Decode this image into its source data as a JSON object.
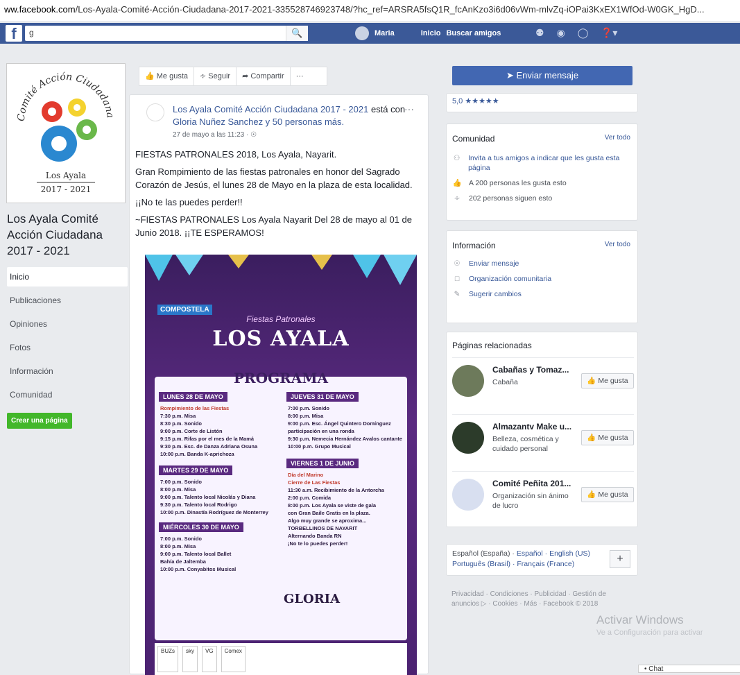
{
  "browser": {
    "domain": "ww.facebook.com",
    "url_path": "/Los-Ayala-Comité-Acción-Ciudadana-2017-2021-335528746923748/?hc_ref=ARSRA5fsQ1R_fcAnKzo3i6d06vWm-mlvZq-iOPai3KxEX1WfOd-W0GK_HgD..."
  },
  "topbar": {
    "search_value": "g",
    "user_name": "Maria",
    "nav_home": "Inicio",
    "nav_find_friends": "Buscar amigos"
  },
  "profile": {
    "logo_text_top": "Comité Acción Ciudadana",
    "logo_text_place": "Los Ayala",
    "logo_text_years": "2017 - 2021",
    "page_name": "Los Ayala Comité Acción Ciudadana 2017 - 2021"
  },
  "left_nav": {
    "items": [
      "Inicio",
      "Publicaciones",
      "Opiniones",
      "Fotos",
      "Información",
      "Comunidad"
    ],
    "create_page": "Crear una página"
  },
  "actions": {
    "like": "Me gusta",
    "follow": "Seguir",
    "share": "Compartir",
    "more": "···"
  },
  "post": {
    "author": "Los Ayala Comité Acción Ciudadana 2017 - 2021",
    "with_text": "está con",
    "tagged": "Gloria Nuñez Sanchez y 50 personas más.",
    "date": "27 de mayo a las 11:23 ·",
    "p1": "FIESTAS PATRONALES 2018, Los Ayala, Nayarit.",
    "p2": "Gran Rompimiento de las fiestas patronales en honor del Sagrado Corazón de Jesús, el lunes 28 de Mayo en la plaza de esta localidad.",
    "p3": "¡¡No te las puedes perder!!",
    "p4": "~FIESTAS PATRONALES Los Ayala Nayarit Del 28 de mayo al 01 de Junio 2018. ¡¡TE ESPERAMOS!"
  },
  "poster": {
    "compostela": "COMPOSTELA",
    "subtitle": "Fiestas Patronales",
    "title": "LOS AYALA",
    "programa": "PROGRAMA",
    "day1": "LUNES 28 DE MAYO",
    "day1_lines": [
      "Rompimiento de las Fiestas",
      "7:30 p.m.  Misa",
      "8:30 p.m.  Sonido",
      "9:00 p.m.  Corte de Listón",
      "9:15 p.m.  Rifas por el mes de la Mamá",
      "9:30 p.m.  Esc. de Danza Adriana Osuna",
      "10:00 p.m.  Banda K-aprichoza"
    ],
    "day2": "MARTES 29 DE MAYO",
    "day2_lines": [
      "7:00 p.m.  Sonido",
      "8:00 p.m.  Misa",
      "9:00 p.m.  Talento local Nicolás y Diana",
      "9:30 p.m.  Talento local Rodrigo",
      "10:00 p.m.  Dinastía Rodríguez de Monterrey"
    ],
    "day3": "MIÉRCOLES 30 DE MAYO",
    "day3_lines": [
      "7:00 p.m.  Sonido",
      "8:00 p.m.  Misa",
      "9:00 p.m.  Talento local Ballet",
      "Bahía de Jaltemba",
      "10:00 p.m.  Conyabitos Musical"
    ],
    "day4": "JUEVES 31 DE MAYO",
    "day4_lines": [
      "7:00 p.m.  Sonido",
      "8:00 p.m.  Misa",
      "9:00 p.m.  Esc. Ángel Quintero Domínguez",
      "participación en una ronda",
      "9:30 p.m.  Nemecia Hernández Avalos cantante",
      "10:00 p.m.  Grupo Musical"
    ],
    "day5": "VIERNES 1 DE JUNIO",
    "day5_lines": [
      "Día del Marino",
      "Cierre de Las Fiestas",
      "11:30 a.m.  Recibimiento de la Antorcha",
      "2:00 p.m.  Comida",
      "8:00 p.m.  Los Ayala se viste de gala",
      "con Gran Baile Gratis en la plaza.",
      "Algo muy grande se aproxima...",
      "TORBELLINOS DE NAYARIT",
      "Alternando Banda RN",
      "¡No te lo puedes perder!"
    ],
    "gloria": "GLORIA",
    "sponsors": [
      "BUZs",
      "sky",
      "VG",
      "Comex"
    ]
  },
  "right": {
    "send_message": "Enviar mensaje",
    "rating": "5,0 ★★★★★",
    "community_title": "Comunidad",
    "see_all": "Ver todo",
    "invite": "Invita a tus amigos a indicar que les gusta esta página",
    "likes": "A 200 personas les gusta esto",
    "follows": "202 personas siguen esto",
    "info_title": "Información",
    "info_send": "Enviar mensaje",
    "info_org": "Organización comunitaria",
    "info_suggest": "Sugerir cambios",
    "related_title": "Páginas relacionadas",
    "related": [
      {
        "name": "Cabañas y Tomaz...",
        "cat": "Cabaña"
      },
      {
        "name": "Almazantv Make u...",
        "cat": "Belleza, cosmética y cuidado personal"
      },
      {
        "name": "Comité Peñita 201...",
        "cat": "Organización sin ánimo de lucro"
      }
    ],
    "like_btn": "Me gusta",
    "languages_1": "Español (España) · ",
    "languages_2": "Español · English (US)",
    "languages_3": "Português (Brasil) · Français (France)",
    "footer": "Privacidad · Condiciones · Publicidad · Gestión de anuncios ▷ · Cookies · Más · Facebook © 2018"
  },
  "overlay": {
    "activate": "Activar Windows",
    "activate_sub": "Ve a Configuración para activar",
    "chat": "• Chat"
  },
  "colors": {
    "fb_blue": "#3b5998",
    "button_blue": "#4267b2",
    "green": "#42b72a",
    "poster_purple": "#5a2a80"
  }
}
